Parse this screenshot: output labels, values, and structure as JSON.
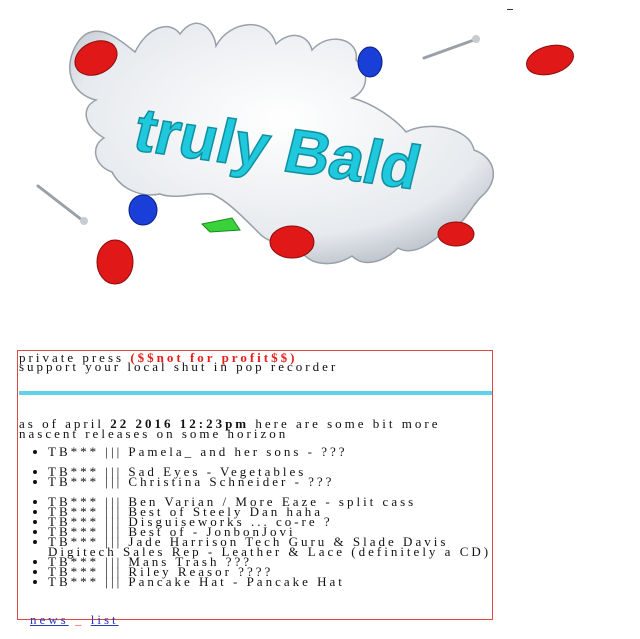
{
  "logo": {
    "text": "truly Bald",
    "colors": {
      "splash": "#f2f4f6",
      "text": "#1fc8dc",
      "red": "#e01818",
      "blue": "#1a3fd8",
      "green": "#3ad23a"
    }
  },
  "panel": {
    "press_label": "private press",
    "press_note": "($$not for profit$$)",
    "support": "support your local shut in pop recorder",
    "asof_prefix": "as of april",
    "asof_date": "22 2016 12:23pm",
    "asof_suffix": "here are some bit more nascent releases on some horizon",
    "releases": [
      "TB*** ||| Pamela_ and her sons - ???",
      "TB*** ||| Sad Eyes - Vegetables",
      "TB*** ||| Christina Schneider - ???",
      "TB*** ||| Ben Varian / More Eaze - split cass",
      "TB*** ||| Best of Steely Dan haha",
      "TB*** ||| Disguiseworks ... co-re ?",
      "TB*** ||| Best of - JonbonJovi",
      "TB*** ||| Jade Harrison Tech Guru & Slade Davis Digitech Sales Rep - Leather & Lace (definitely a CD)",
      "TB*** ||| Mans Trash ???",
      "TB*** ||| Riley Reasor ????",
      "TB*** ||| Pancake Hat - Pancake Hat"
    ]
  },
  "footer": {
    "news": "news",
    "sep": "_",
    "list": "list"
  },
  "colors": {
    "border": "#e04848",
    "bar": "#5fd3ea",
    "link": "#2a36b8",
    "highlight": "#e8201c"
  }
}
